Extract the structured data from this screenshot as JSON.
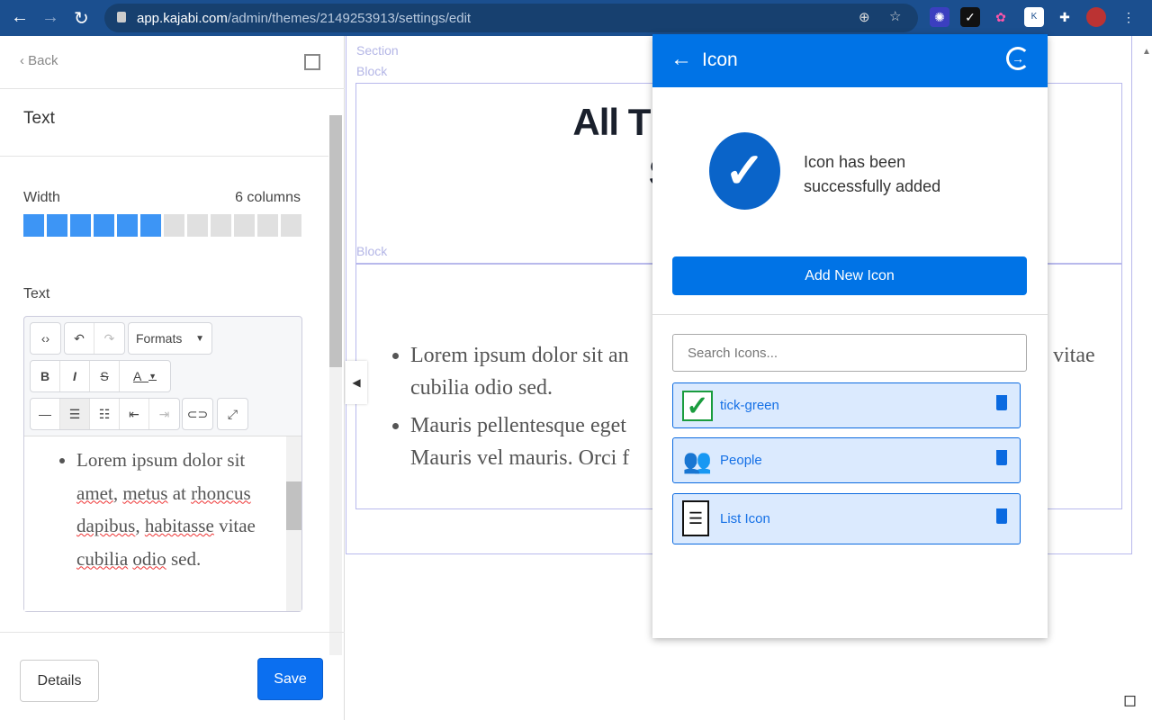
{
  "browser": {
    "url_host": "app.kajabi.com",
    "url_path": "/admin/themes/2149253913/settings/edit"
  },
  "sidebar": {
    "back": "Back",
    "section_title": "Text",
    "width_label": "Width",
    "width_value": "6 columns",
    "width_selected": 6,
    "width_total": 12,
    "text_label": "Text",
    "toolbar": {
      "formats": "Formats"
    },
    "editor_content": {
      "words": [
        "Lorem ipsum dolor sit ",
        "amet",
        ", ",
        "metus",
        " at ",
        "rhoncus",
        " ",
        "dapibus",
        ", ",
        "habitasse",
        " vitae ",
        "cubilia",
        " ",
        "odio",
        " sed."
      ]
    },
    "details_button": "Details",
    "save_button": "Save"
  },
  "preview": {
    "section_tag": "Section",
    "block_tag_1": "Block",
    "block_tag_2": "Block",
    "heading_line1": "All The Tool",
    "heading_line2": "Successf",
    "bullets": [
      {
        "line1": "Lorem ipsum dolor sit an",
        "line1_end": "vitae",
        "line2": "cubilia odio sed."
      },
      {
        "line1": "Mauris pellentesque eget",
        "line2": "Mauris vel mauris. Orci f"
      }
    ]
  },
  "popup": {
    "title": "Icon",
    "success_line1": "Icon has been",
    "success_line2": "successfully added",
    "add_button": "Add New Icon",
    "search_placeholder": "Search Icons...",
    "icons": [
      {
        "name": "tick-green",
        "icon": "green-check-icon"
      },
      {
        "name": "People",
        "icon": "people-icon"
      },
      {
        "name": "List Icon",
        "icon": "list-document-icon"
      }
    ]
  },
  "colors": {
    "accent": "#0073e6",
    "browser_bar": "#1b4f8f",
    "save": "#0b6ff0"
  }
}
